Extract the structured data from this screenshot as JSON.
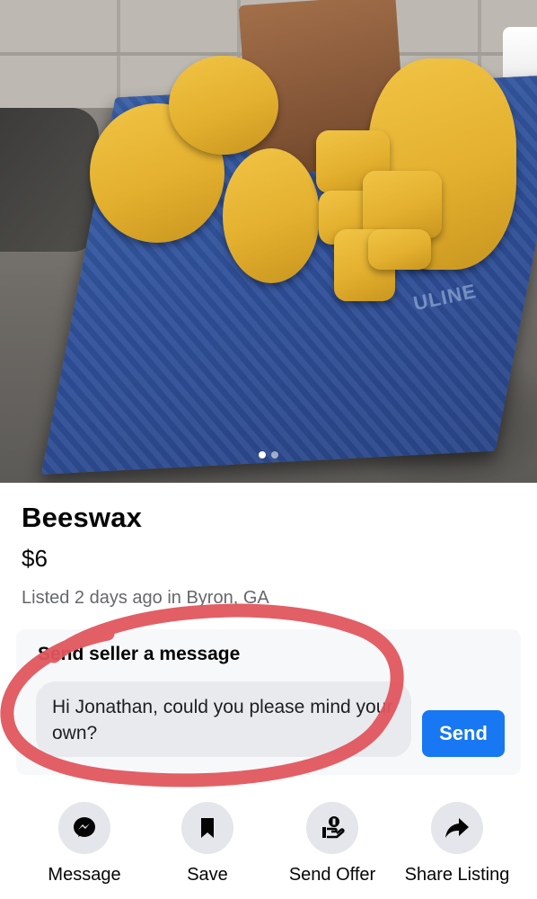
{
  "photo": {
    "watermark_text": "ULINE",
    "carousel": {
      "total": 2,
      "active_index": 0
    }
  },
  "listing": {
    "title": "Beeswax",
    "price": "$6",
    "meta": "Listed 2 days ago in Byron, GA"
  },
  "message": {
    "heading": "Send seller a message",
    "input_value": "Hi Jonathan, could you please mind your own?",
    "send_label": "Send"
  },
  "actions": [
    {
      "label": "Message",
      "icon": "messenger-icon"
    },
    {
      "label": "Save",
      "icon": "bookmark-icon"
    },
    {
      "label": "Send Offer",
      "icon": "offer-hand-icon"
    },
    {
      "label": "Share Listing",
      "icon": "share-arrow-icon"
    }
  ],
  "colors": {
    "accent": "#1877f2",
    "annotation_red": "#e0565e",
    "icon_bg": "#e4e6eb",
    "secondary_text": "#65676b"
  }
}
